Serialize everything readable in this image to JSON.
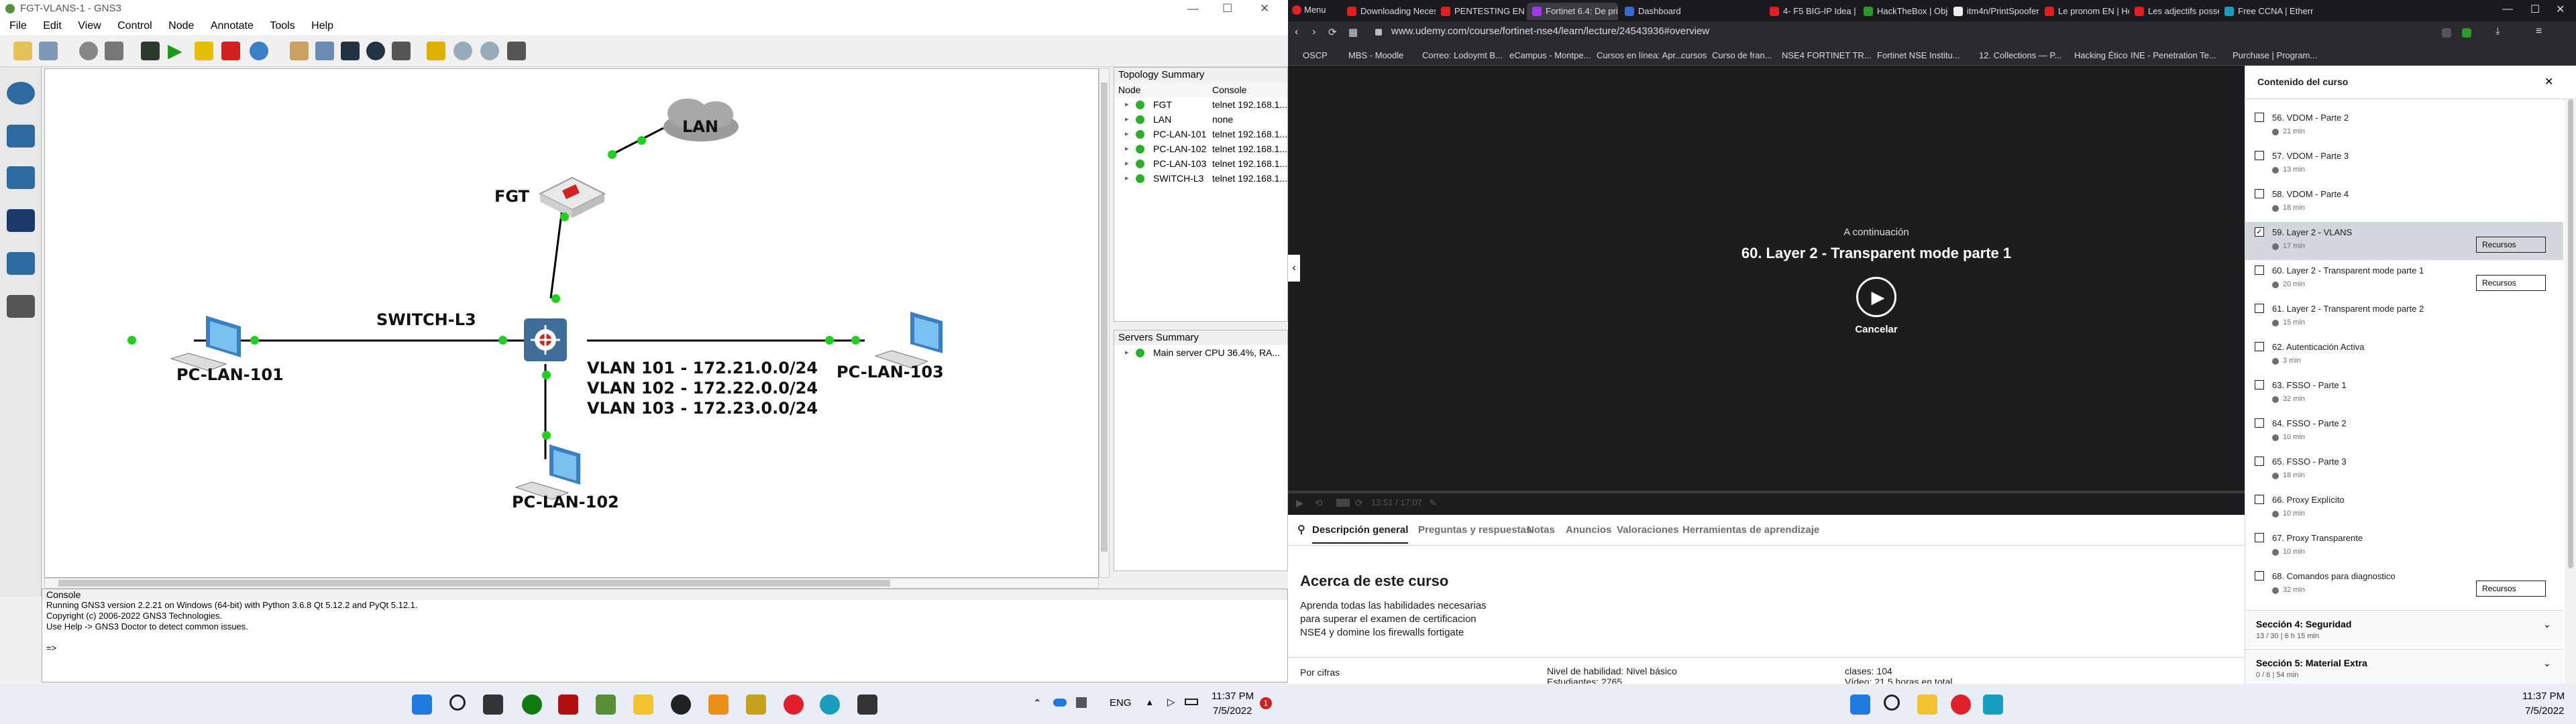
{
  "gns3": {
    "window_title": "FGT-VLANS-1 - GNS3",
    "menu": [
      "File",
      "Edit",
      "View",
      "Control",
      "Node",
      "Annotate",
      "Tools",
      "Help"
    ],
    "nodes": {
      "lan": "LAN",
      "fgt": "FGT",
      "switch": "SWITCH-L3",
      "pc101": "PC-LAN-101",
      "pc102": "PC-LAN-102",
      "pc103": "PC-LAN-103"
    },
    "vlans": [
      "VLAN 101 - 172.21.0.0/24",
      "VLAN 102 - 172.22.0.0/24",
      "VLAN 103 - 172.23.0.0/24"
    ],
    "topology_summary": {
      "title": "Topology Summary",
      "col_node": "Node",
      "col_console": "Console",
      "rows": [
        {
          "node": "FGT",
          "console": "telnet 192.168.1..."
        },
        {
          "node": "LAN",
          "console": "none"
        },
        {
          "node": "PC-LAN-101",
          "console": "telnet 192.168.1..."
        },
        {
          "node": "PC-LAN-102",
          "console": "telnet 192.168.1..."
        },
        {
          "node": "PC-LAN-103",
          "console": "telnet 192.168.1..."
        },
        {
          "node": "SWITCH-L3",
          "console": "telnet 192.168.1..."
        }
      ]
    },
    "servers_summary": {
      "title": "Servers Summary",
      "row": "Main server CPU 36.4%, RA..."
    },
    "console": {
      "title": "Console",
      "lines": [
        "Running GNS3 version 2.2.21 on Windows (64-bit) with Python 3.6.8 Qt 5.12.2 and PyQt 5.12.1.",
        "Copyright (c) 2006-2022 GNS3 Technologies.",
        "Use Help -> GNS3 Doctor to detect common issues.",
        "",
        "=>"
      ]
    }
  },
  "taskbar_left": {
    "lang": "ENG",
    "time": "11:37 PM",
    "date": "7/5/2022",
    "badge": "1"
  },
  "taskbar_right": {
    "time": "11:37 PM",
    "date": "7/5/2022"
  },
  "browser": {
    "menu": "Menu",
    "tabs": [
      "Downloading Necess...",
      "PENTESTING EN ESP...",
      "Fortinet 6.4: De prin...",
      "Dashboard",
      "4- F5 BIG-IP Idea | F...",
      "HackTheBox | Objec...",
      "itm4n/PrintSpoofer...",
      "Le pronom EN | Hov...",
      "Les adjectifs posses...",
      "Free CCNA | Etherne..."
    ],
    "url": "www.udemy.com/course/fortinet-nse4/learn/lecture/24543936#overview",
    "bookmarks": [
      "OSCP",
      "MBS - Moodle",
      "Correo: Lodoymt B...",
      "eCampus - Montpe...",
      "Cursos en línea: Apr...",
      "cursos",
      "Curso de fran...",
      "NSE4 FORTINET TR...",
      "Fortinet NSE Institu...",
      "12. Collections — P...",
      "Hacking Ético",
      "INE - Penetration Te...",
      "Purchase | Program..."
    ],
    "video": {
      "next_label": "A continuación",
      "next_title": "60. Layer 2 - Transparent mode parte 1",
      "cancel": "Cancelar",
      "timecode": "13:51 / 17:07"
    },
    "course_tabs": [
      "Descripción general",
      "Preguntas y respuestas",
      "Notas",
      "Anuncios",
      "Valoraciones",
      "Herramientas de aprendizaje"
    ],
    "about": {
      "title": "Acerca de este curso",
      "desc": "Aprenda todas las habilidades necesarias para superar el examen de certificacion NSE4 y domine los firewalls fortigate",
      "by_numbers": "Por cifras",
      "level": "Nivel de habilidad: Nivel básico",
      "students": "Estudiantes: 2765",
      "classes": "clases: 104",
      "video": "Vídeo: 21,5 horas en total"
    },
    "sidebar": {
      "title": "Contenido del curso",
      "items": [
        {
          "title": "56. VDOM - Parte 2",
          "dur": "21 min",
          "checked": false,
          "res": false
        },
        {
          "title": "57. VDOM - Parte 3",
          "dur": "13 min",
          "checked": false,
          "res": false
        },
        {
          "title": "58. VDOM - Parte 4",
          "dur": "18 min",
          "checked": false,
          "res": false
        },
        {
          "title": "59. Layer 2 - VLANS",
          "dur": "17 min",
          "checked": true,
          "res": true
        },
        {
          "title": "60. Layer 2 - Transparent mode parte 1",
          "dur": "20 min",
          "checked": false,
          "res": true
        },
        {
          "title": "61. Layer 2 - Transparent mode parte 2",
          "dur": "15 min",
          "checked": false,
          "res": false
        },
        {
          "title": "62. Autenticación Activa",
          "dur": "3 min",
          "checked": false,
          "res": false
        },
        {
          "title": "63. FSSO - Parte 1",
          "dur": "32 min",
          "checked": false,
          "res": false
        },
        {
          "title": "64. FSSO - Parte 2",
          "dur": "10 min",
          "checked": false,
          "res": false
        },
        {
          "title": "65. FSSO - Parte 3",
          "dur": "18 min",
          "checked": false,
          "res": false
        },
        {
          "title": "66. Proxy Explícito",
          "dur": "10 min",
          "checked": false,
          "res": false
        },
        {
          "title": "67. Proxy Transparente",
          "dur": "10 min",
          "checked": false,
          "res": false
        },
        {
          "title": "68. Comandos para diagnostico",
          "dur": "32 min",
          "checked": false,
          "res": true
        }
      ],
      "resources": "Recursos",
      "sections": [
        {
          "title": "Sección 4: Seguridad",
          "meta": "13 / 30 | 6 h 15 min"
        },
        {
          "title": "Sección 5: Material Extra",
          "meta": "0 / 6 | 54 min"
        }
      ]
    }
  }
}
